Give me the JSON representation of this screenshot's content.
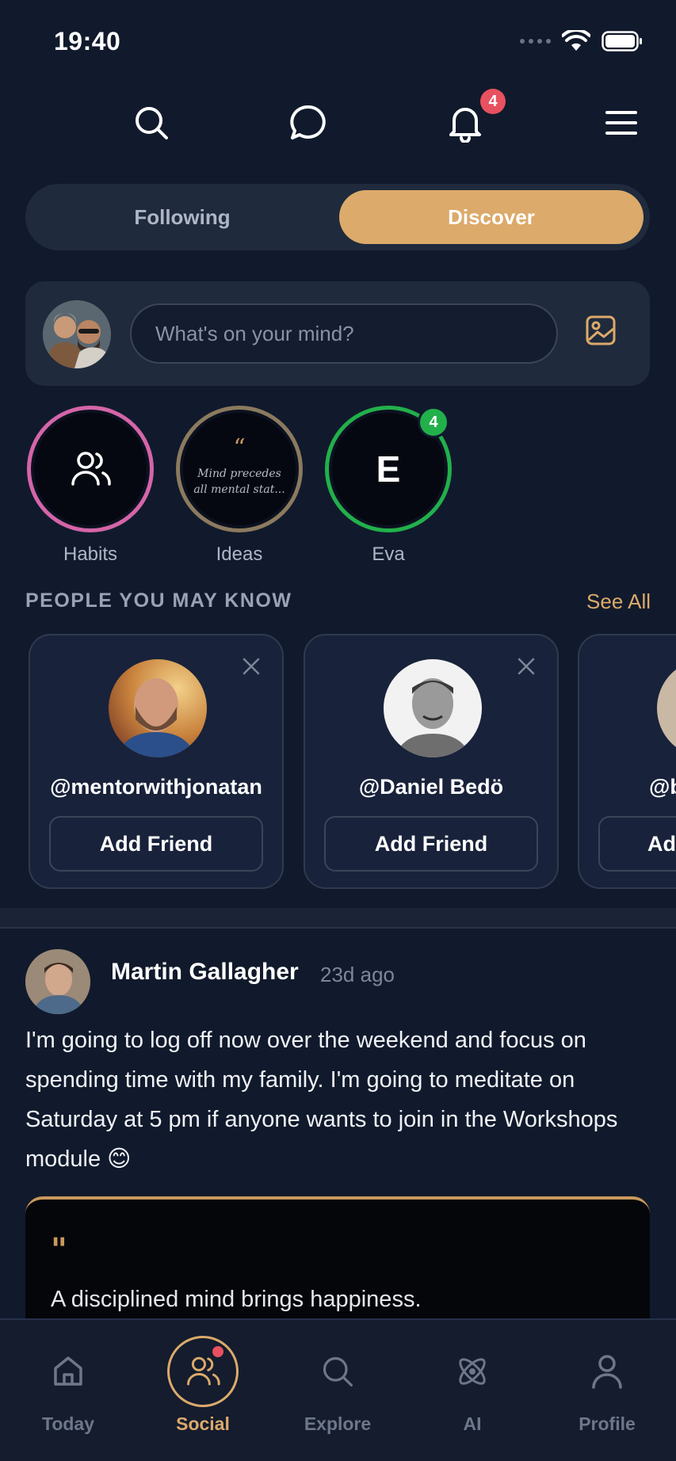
{
  "status_bar": {
    "time": "19:40"
  },
  "top_nav": {
    "notification_count": "4"
  },
  "segment": {
    "following": "Following",
    "discover": "Discover",
    "active": "Discover"
  },
  "composer": {
    "placeholder": "What's on your mind?"
  },
  "stories": [
    {
      "label": "Habits",
      "ring_color": "#d465a8"
    },
    {
      "label": "Ideas",
      "ring_color": "#8b7a5e",
      "quote": "Mind precedes all mental stat..."
    },
    {
      "label": "Eva",
      "ring_color": "#22b04b",
      "letter": "E",
      "badge": "4"
    }
  ],
  "people": {
    "title": "PEOPLE YOU MAY KNOW",
    "see_all": "See All",
    "cards": [
      {
        "name": "@mentorwithjonatan",
        "action": "Add Friend"
      },
      {
        "name": "@Daniel Bedö",
        "action": "Add Friend"
      },
      {
        "name": "@b",
        "action": "Ad"
      }
    ]
  },
  "post": {
    "author": "Martin Gallagher",
    "time": "23d ago",
    "body": "I'm going to log off now over the weekend and focus on spending time with my family. I'm going to meditate on Saturday at 5 pm if anyone wants to join in the Workshops module 😊",
    "quote_mark": "\"",
    "quote": "A disciplined mind brings happiness."
  },
  "bottom_nav": {
    "items": [
      "Today",
      "Social",
      "Explore",
      "AI",
      "Profile"
    ],
    "active": "Social"
  },
  "colors": {
    "accent": "#dcaa6a",
    "background": "#111a2c",
    "badge": "#e8515f"
  }
}
